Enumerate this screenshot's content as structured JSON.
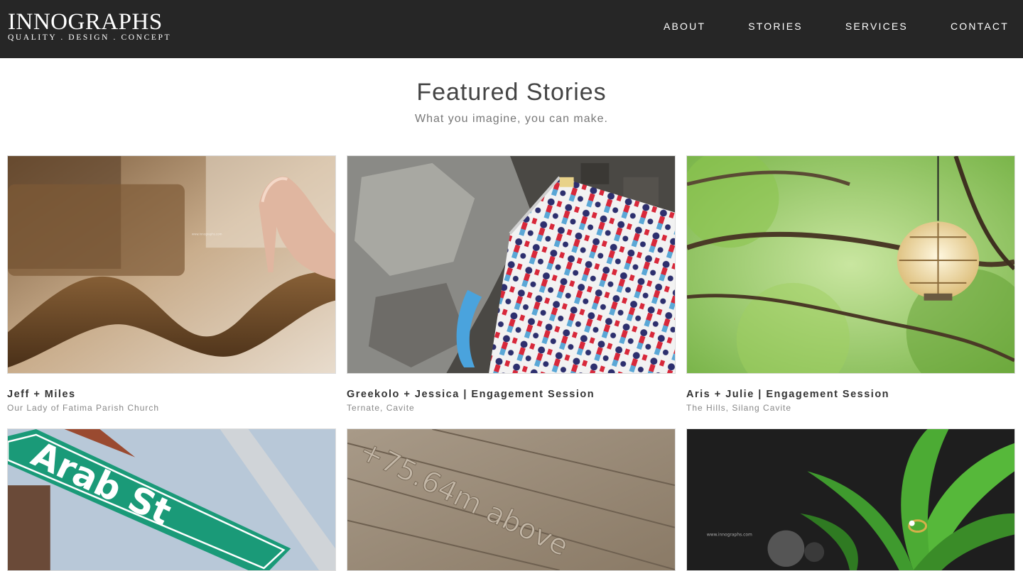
{
  "brand": {
    "name": "INNOGRAPHS",
    "tagline": "QUALITY . DESIGN . CONCEPT"
  },
  "nav": {
    "items": [
      "ABOUT",
      "STORIES",
      "SERVICES",
      "CONTACT"
    ]
  },
  "intro": {
    "title": "Featured Stories",
    "subtitle": "What you imagine, you can make."
  },
  "stories": [
    {
      "title": "Jeff + Miles",
      "location": "Our Lady of Fatima Parish Church"
    },
    {
      "title": "Greekolo + Jessica | Engagement Session",
      "location": "Ternate, Cavite"
    },
    {
      "title": "Aris + Julie | Engagement Session",
      "location": "The Hills, Silang Cavite"
    }
  ],
  "photos": {
    "sign_text": "Arab St",
    "wood_text": "+75.64m above",
    "watermark": "www.innographs.com"
  },
  "colors": {
    "header_bg": "#262626",
    "sign_green": "#1a9a78"
  }
}
